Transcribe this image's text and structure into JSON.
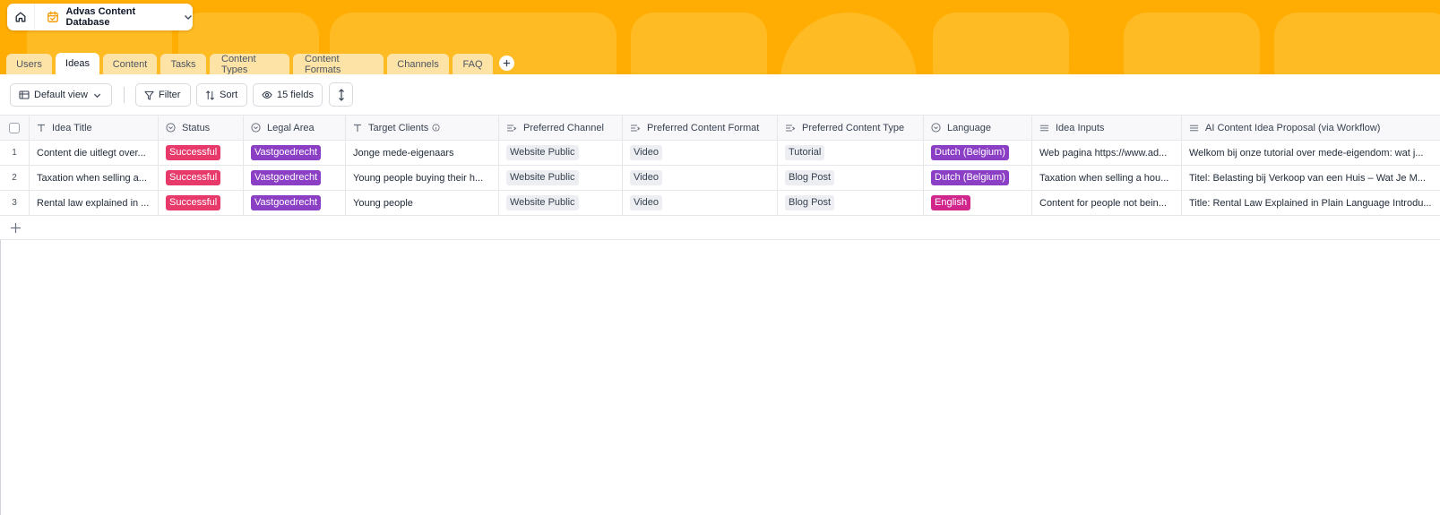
{
  "app": {
    "database_name": "Advas Content Database",
    "home_icon": "home-icon",
    "db_icon": "calendar-icon",
    "accent": "#ffad03"
  },
  "tabs": [
    {
      "label": "Users",
      "active": false
    },
    {
      "label": "Ideas",
      "active": true
    },
    {
      "label": "Content",
      "active": false
    },
    {
      "label": "Tasks",
      "active": false
    },
    {
      "label": "Content Types",
      "active": false
    },
    {
      "label": "Content Formats",
      "active": false
    },
    {
      "label": "Channels",
      "active": false
    },
    {
      "label": "FAQ",
      "active": false
    }
  ],
  "toolbar": {
    "view_label": "Default view",
    "filter_label": "Filter",
    "sort_label": "Sort",
    "fields_label": "15 fields"
  },
  "columns": [
    {
      "label": "Idea Title",
      "icon": "text-icon"
    },
    {
      "label": "Status",
      "icon": "single-select-icon"
    },
    {
      "label": "Legal Area",
      "icon": "single-select-icon"
    },
    {
      "label": "Target Clients",
      "icon": "text-icon",
      "info": true
    },
    {
      "label": "Preferred Channel",
      "icon": "link-icon"
    },
    {
      "label": "Preferred Content Format",
      "icon": "link-icon"
    },
    {
      "label": "Preferred Content Type",
      "icon": "link-icon"
    },
    {
      "label": "Language",
      "icon": "single-select-icon"
    },
    {
      "label": "Idea Inputs",
      "icon": "long-text-icon"
    },
    {
      "label": "AI Content Idea Proposal (via Workflow)",
      "icon": "long-text-icon"
    }
  ],
  "rows": [
    {
      "num": "1",
      "title": "Content die uitlegt over...",
      "status": "Successful",
      "legal_area": "Vastgoedrecht",
      "target_clients": "Jonge mede-eigenaars",
      "channel": "Website Public",
      "format": "Video",
      "content_type": "Tutorial",
      "language": "Dutch (Belgium)",
      "language_color": "purple",
      "inputs": "Web pagina https://www.ad...",
      "proposal": "Welkom bij onze tutorial over mede-eigendom: wat j..."
    },
    {
      "num": "2",
      "title": "Taxation when selling a...",
      "status": "Successful",
      "legal_area": "Vastgoedrecht",
      "target_clients": "Young people buying their h...",
      "channel": "Website Public",
      "format": "Video",
      "content_type": "Blog Post",
      "language": "Dutch (Belgium)",
      "language_color": "purple",
      "inputs": "Taxation when selling a hou...",
      "proposal": "Titel: Belasting bij Verkoop van een Huis – Wat Je M..."
    },
    {
      "num": "3",
      "title": "Rental law explained in ...",
      "status": "Successful",
      "legal_area": "Vastgoedrecht",
      "target_clients": "Young people",
      "channel": "Website Public",
      "format": "Video",
      "content_type": "Blog Post",
      "language": "English",
      "language_color": "pink",
      "inputs": "Content for people not bein...",
      "proposal": "Title: Rental Law Explained in Plain Language Introdu..."
    }
  ]
}
